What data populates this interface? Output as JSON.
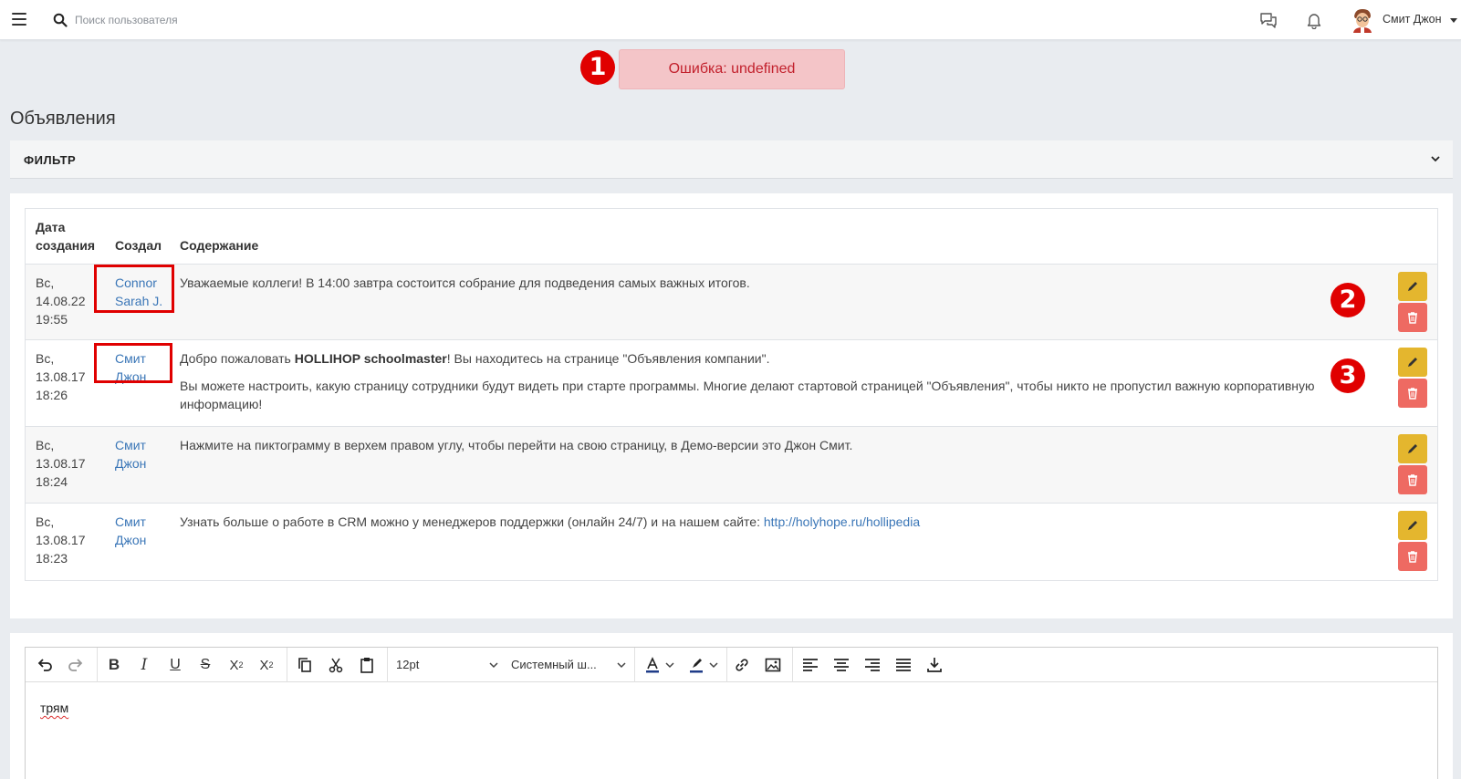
{
  "topbar": {
    "search_placeholder": "Поиск пользователя",
    "user_name": "Смит Джон"
  },
  "error": {
    "marker": "1",
    "message": "Ошибка: undefined"
  },
  "page_title": "Объявления",
  "filter": {
    "label": "ФИЛЬТР"
  },
  "table": {
    "headers": {
      "date_line1": "Дата",
      "date_line2": "создания",
      "author": "Создал",
      "content": "Содержание"
    },
    "rows": [
      {
        "date": [
          "Вс,",
          "14.08.22",
          "19:55"
        ],
        "author": [
          "Connor",
          "Sarah J."
        ],
        "content_text": "Уважаемые коллеги! В 14:00 завтра состоится собрание для подведения самых важных итогов."
      },
      {
        "date": [
          "Вс,",
          "13.08.17",
          "18:26"
        ],
        "author": [
          "Смит",
          "Джон"
        ],
        "content_pre": "Добро пожаловать ",
        "content_bold": "HOLLIHOP schoolmaster",
        "content_post": "! Вы находитесь на странице \"Объявления компании\".",
        "content_p2": "Вы можете настроить, какую страницу сотрудники будут видеть при старте программы. Многие делают стартовой страницей \"Объявления\", чтобы никто не пропустил важную корпоративную информацию!"
      },
      {
        "date": [
          "Вс,",
          "13.08.17",
          "18:24"
        ],
        "author": [
          "Смит",
          "Джон"
        ],
        "content_text": "Нажмите на пиктограмму в верхем правом углу, чтобы перейти на свою страницу, в Демо-версии это Джон Смит."
      },
      {
        "date": [
          "Вс,",
          "13.08.17",
          "18:23"
        ],
        "author": [
          "Смит",
          "Джон"
        ],
        "content_pre": "Узнать больше о работе в CRM можно у менеджеров поддержки (онлайн 24/7) и на нашем сайте: ",
        "content_link": "http://holyhope.ru/hollipedia"
      }
    ]
  },
  "markers": {
    "m2": "2",
    "m3": "3"
  },
  "editor": {
    "font_size": "12pt",
    "font_family": "Системный ш...",
    "text": "трям"
  },
  "colors": {
    "edit_button": "#e4b62e",
    "delete_button": "#ee6a62",
    "link": "#3a76b7",
    "error_bg": "#f4c5c8",
    "error_text": "#c2202c",
    "annotation_red": "#e00000"
  }
}
